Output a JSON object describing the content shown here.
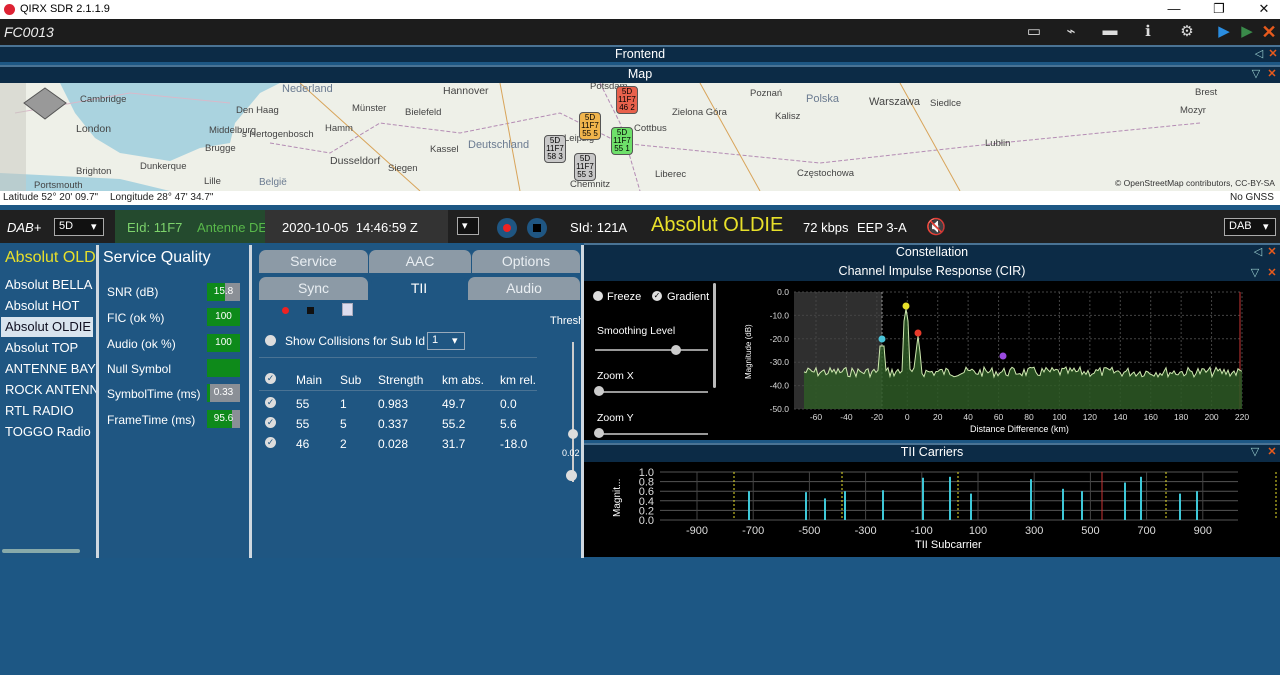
{
  "app": {
    "title": "QIRX SDR 2.1.1.9",
    "file": "FC0013"
  },
  "window": {
    "minimize": "—",
    "maximize": "❐",
    "close": "✕"
  },
  "toolbar": {
    "map": "▭",
    "satellite": "⌁",
    "line": "▬",
    "info": "ℹ",
    "settings": "⚙",
    "play": "▶",
    "play2": "▶",
    "stop": "✕"
  },
  "headers": {
    "frontend": "Frontend",
    "map": "Map",
    "constellation": "Constellation",
    "cir": "Channel Impulse Response (CIR)",
    "tiic": "TII Carriers"
  },
  "map": {
    "countries": [
      {
        "t": "Nederland"
      },
      {
        "t": "Deutschland"
      },
      {
        "t": "Polska"
      },
      {
        "t": "België"
      }
    ],
    "cities": [
      "Cambridge",
      "London",
      "Brighton",
      "Portsmouth",
      "Middelburg",
      "Brugge",
      "Dunkerque",
      "Lille",
      "Den Haag",
      "'s Hertogenbosch",
      "Dusseldorf",
      "Siegen",
      "Hannover",
      "Bielefeld",
      "Kassel",
      "Potsdam",
      "Cottbus",
      "Zielona Góra",
      "Chemnitz",
      "Liberec",
      "Poznań",
      "Kalisz",
      "Warszawa",
      "Siedlce",
      "Częstochowa",
      "Lublin",
      "Mozyr",
      "Münster",
      "Hamm",
      "Leipzig",
      "Brest"
    ],
    "pins": [
      {
        "l1": "5D",
        "l2": "11F7",
        "l3": "46",
        "l4": "2"
      },
      {
        "l1": "5D",
        "l2": "11F7",
        "l3": "55",
        "l4": "5"
      },
      {
        "l1": "5D",
        "l2": "11F7",
        "l3": "55",
        "l4": "1"
      },
      {
        "l1": "5D",
        "l2": "11F7",
        "l3": "58",
        "l4": "3"
      },
      {
        "l1": "5D",
        "l2": "11F7",
        "l3": "55",
        "l4": "3"
      }
    ],
    "attrib": "© OpenStreetMap contributors, CC-BY-SA",
    "latitude": "Latitude 52° 20' 09.7\"",
    "longitude": "Longitude 28° 47' 34.7\"",
    "gnss": "No GNSS"
  },
  "control": {
    "mode": "DAB+",
    "channel": "5D",
    "eid": "EId: 11F7",
    "ensemble": "Antenne DE",
    "datetime": "2020-10-05  14:46:59 Z",
    "sid": "SId: 121A",
    "service": "Absolut OLDIE",
    "bitrate": "72 kbps",
    "eep": "EEP 3-A",
    "mode2": "DAB"
  },
  "services": {
    "selected": "Absolut OLDIE",
    "items": [
      "Absolut BELLA",
      "Absolut HOT",
      "Absolut OLDIE",
      "Absolut TOP",
      "ANTENNE BAYERN",
      "ROCK ANTENNE",
      "RTL RADIO",
      "TOGGO Radio"
    ]
  },
  "quality": {
    "title": "Service Quality",
    "rows": [
      {
        "label": "SNR (dB)",
        "value": "15.8",
        "fill": 0.55
      },
      {
        "label": "FIC (ok %)",
        "value": "100",
        "fill": 1.0
      },
      {
        "label": "Audio (ok %)",
        "value": "100",
        "fill": 1.0
      },
      {
        "label": "Null Symbol",
        "value": "",
        "fill": 1.0
      },
      {
        "label": "SymbolTime (ms)",
        "value": "0.33",
        "fill": 0.1
      },
      {
        "label": "FrameTime (ms)",
        "value": "95.6",
        "fill": 0.75
      }
    ]
  },
  "tabs": {
    "row1": [
      "Service",
      "AAC",
      "Options"
    ],
    "row2": [
      "Sync",
      "TII",
      "Audio"
    ],
    "selected": "TII"
  },
  "tii": {
    "collisions": "Show Collisions for Sub Id",
    "subid": "1",
    "thresh": "Thresh",
    "thresh_val": "0.02",
    "headers": [
      "Main",
      "Sub",
      "Strength",
      "km abs.",
      "km rel."
    ],
    "rows": [
      [
        "55",
        "1",
        "0.983",
        "49.7",
        "0.0"
      ],
      [
        "55",
        "5",
        "0.337",
        "55.2",
        "5.6"
      ],
      [
        "46",
        "2",
        "0.028",
        "31.7",
        "-18.0"
      ]
    ]
  },
  "cir": {
    "freeze": "Freeze",
    "gradient": "Gradient",
    "smoothing": "Smoothing Level",
    "zoomx": "Zoom X",
    "zoomy": "Zoom Y",
    "ylabel": "Magnitude (dB)",
    "xlabel": "Distance Difference (km)",
    "yticks": [
      "0.0",
      "-10.0",
      "-20.0",
      "-30.0",
      "-40.0",
      "-50.0"
    ],
    "xticks": [
      "-60",
      "-40",
      "-20",
      "0",
      "20",
      "40",
      "60",
      "80",
      "100",
      "120",
      "140",
      "160",
      "180",
      "200",
      "220"
    ]
  },
  "tiichart": {
    "ylabel": "Magnit...",
    "xlabel": "TII Subcarrier",
    "yticks": [
      "1.0",
      "0.8",
      "0.6",
      "0.4",
      "0.2",
      "0.0"
    ],
    "xticks": [
      "-900",
      "-700",
      "-500",
      "-300",
      "-100",
      "100",
      "300",
      "500",
      "700",
      "900"
    ]
  },
  "colors": {
    "accent": "#e8e02a",
    "green": "#0e8a1a",
    "orange": "#e85a1c",
    "blue": "#1f5682"
  }
}
